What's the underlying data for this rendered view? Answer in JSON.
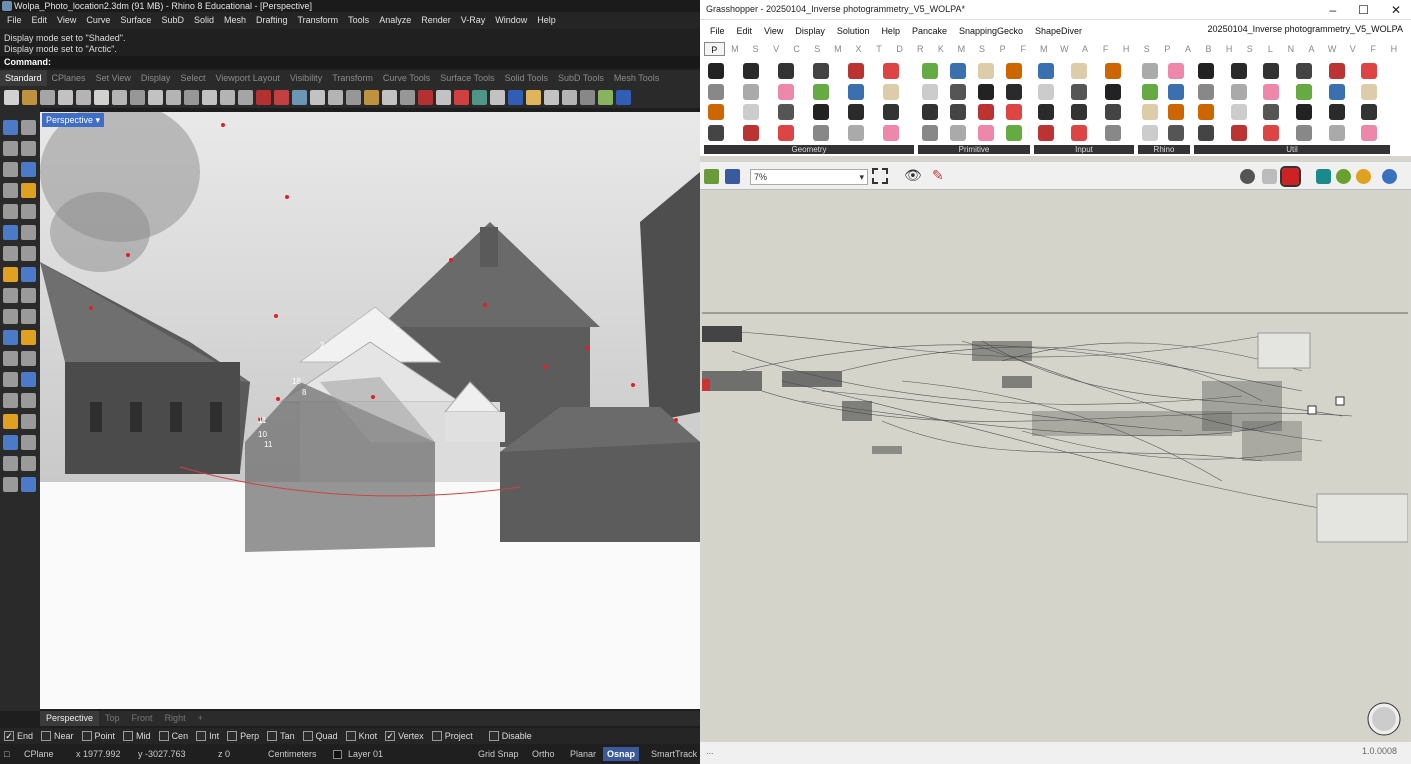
{
  "rhino": {
    "title": "Wolpa_Photo_location2.3dm (91 MB) - Rhino 8 Educational - [Perspective]",
    "menu": [
      "File",
      "Edit",
      "View",
      "Curve",
      "Surface",
      "SubD",
      "Solid",
      "Mesh",
      "Drafting",
      "Transform",
      "Tools",
      "Analyze",
      "Render",
      "V-Ray",
      "Window",
      "Help"
    ],
    "history": [
      "Display mode set to \"Shaded\".",
      "Display mode set to \"Arctic\"."
    ],
    "command_label": "Command:",
    "toolbar_tabs": [
      "Standard",
      "CPlanes",
      "Set View",
      "Display",
      "Select",
      "Viewport Layout",
      "Visibility",
      "Transform",
      "Curve Tools",
      "Surface Tools",
      "Solid Tools",
      "SubD Tools",
      "Mesh Tools"
    ],
    "viewport_label": "Perspective",
    "viewport_tabs": [
      "Perspective",
      "Top",
      "Front",
      "Right",
      "+"
    ],
    "osnaps": [
      {
        "label": "End",
        "checked": true
      },
      {
        "label": "Near",
        "checked": false
      },
      {
        "label": "Point",
        "checked": false
      },
      {
        "label": "Mid",
        "checked": false
      },
      {
        "label": "Cen",
        "checked": false
      },
      {
        "label": "Int",
        "checked": false
      },
      {
        "label": "Perp",
        "checked": false
      },
      {
        "label": "Tan",
        "checked": false
      },
      {
        "label": "Quad",
        "checked": false
      },
      {
        "label": "Knot",
        "checked": false
      },
      {
        "label": "Vertex",
        "checked": true
      },
      {
        "label": "Project",
        "checked": false
      },
      {
        "label": "Disable",
        "checked": false
      }
    ],
    "status": {
      "cplane": "CPlane",
      "x": "x 1977.992",
      "y": "y -3027.763",
      "z": "z 0",
      "units": "Centimeters",
      "layer": "Layer 01",
      "grid_snap": "Grid Snap",
      "ortho": "Ortho",
      "planar": "Planar",
      "osnap": "Osnap",
      "smarttrack": "SmartTrack"
    },
    "point_labels": [
      "2",
      "18",
      "8",
      "11",
      "10",
      "11"
    ]
  },
  "grasshopper": {
    "title": "Grasshopper - 20250104_Inverse photogrammetry_V5_WOLPA*",
    "doc_name": "20250104_Inverse photogrammetry_V5_WOLPA",
    "menu": [
      "File",
      "Edit",
      "View",
      "Display",
      "Solution",
      "Help",
      "Pancake",
      "SnappingGecko",
      "ShapeDiver"
    ],
    "category_tabs": [
      "P",
      "M",
      "S",
      "V",
      "C",
      "S",
      "M",
      "X",
      "T",
      "D",
      "R",
      "K",
      "M",
      "S",
      "P",
      "F",
      "M",
      "W",
      "A",
      "F",
      "H",
      "S",
      "P",
      "A",
      "B",
      "H",
      "S",
      "L",
      "N",
      "A",
      "W",
      "V",
      "F",
      "H"
    ],
    "groups": [
      "Geometry",
      "Primitive",
      "Input",
      "Rhino",
      "Util"
    ],
    "zoom": "7%",
    "version": "1.0.0008",
    "status_left": "..."
  }
}
